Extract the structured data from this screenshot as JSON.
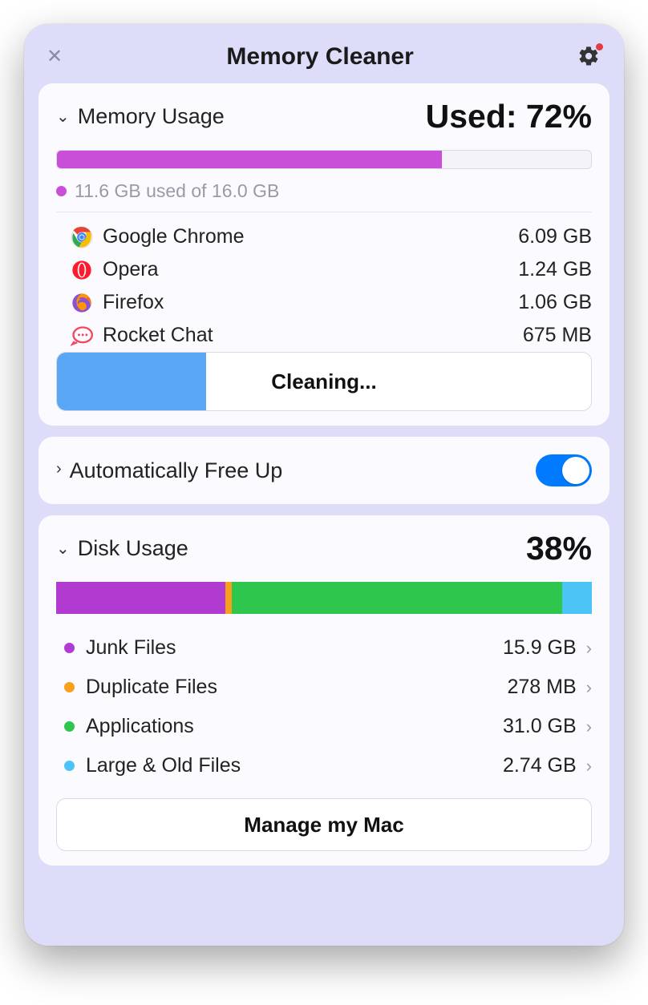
{
  "window": {
    "title": "Memory Cleaner",
    "settings_badge": true
  },
  "memory": {
    "section_title": "Memory Usage",
    "header_value": "Used: 72%",
    "used_percent": 72,
    "caption": "11.6 GB used of 16.0 GB",
    "caption_color": "#c94fd9",
    "apps": [
      {
        "name": "Google Chrome",
        "size": "6.09 GB"
      },
      {
        "name": "Opera",
        "size": "1.24 GB"
      },
      {
        "name": "Firefox",
        "size": "1.06 GB"
      },
      {
        "name": "Rocket Chat",
        "size": "675 MB"
      }
    ],
    "clean_button": {
      "label": "Cleaning...",
      "progress_percent": 28
    }
  },
  "auto_free": {
    "section_title": "Automatically Free Up",
    "enabled": true
  },
  "disk": {
    "section_title": "Disk Usage",
    "header_value": "38%",
    "segments": [
      {
        "name": "Junk Files",
        "size": "15.9 GB",
        "color": "#b13bd1",
        "flex": 31.8
      },
      {
        "name": "Duplicate Files",
        "size": "278 MB",
        "color": "#f8a01b",
        "flex": 1.2
      },
      {
        "name": "Applications",
        "size": "31.0 GB",
        "color": "#2fc64d",
        "flex": 62.0
      },
      {
        "name": "Large & Old Files",
        "size": "2.74 GB",
        "color": "#4cc4f6",
        "flex": 5.5
      }
    ],
    "manage_button": "Manage my Mac"
  },
  "colors": {
    "window_bg": "#ddddf9",
    "card_bg": "#fbfbff",
    "memory_bar_fill": "#c94fd9",
    "cleaning_fill": "#5aa7f5",
    "toggle_on": "#007aff"
  }
}
